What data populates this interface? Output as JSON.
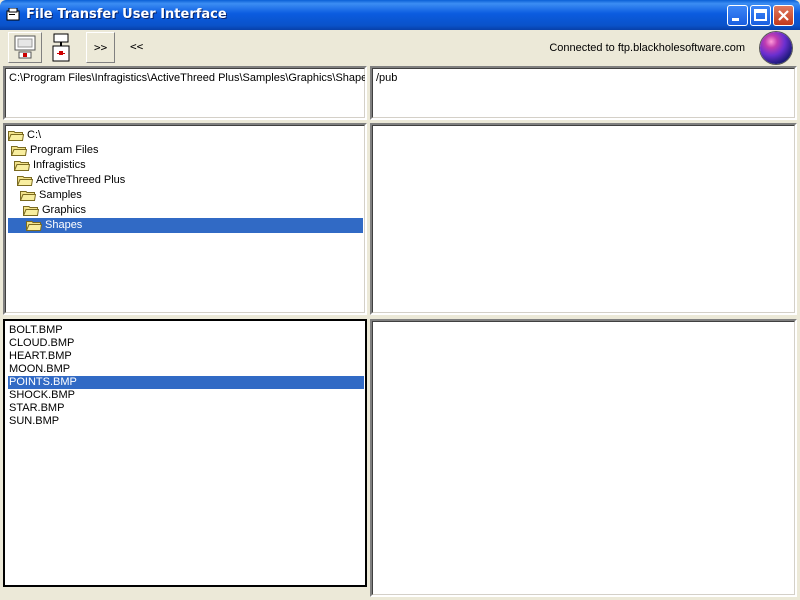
{
  "window": {
    "title": "File Transfer User Interface"
  },
  "toolbar": {
    "forward_label": ">>",
    "back_label": "<<",
    "status": "Connected to ftp.blackholesoftware.com"
  },
  "local": {
    "path": "C:\\Program Files\\Infragistics\\ActiveThreed Plus\\Samples\\Graphics\\Shapes",
    "tree": [
      {
        "label": "C:\\"
      },
      {
        "label": "Program Files"
      },
      {
        "label": "Infragistics"
      },
      {
        "label": "ActiveThreed Plus"
      },
      {
        "label": "Samples"
      },
      {
        "label": "Graphics"
      },
      {
        "label": "Shapes",
        "selected": true
      }
    ],
    "files": [
      {
        "name": "BOLT.BMP"
      },
      {
        "name": "CLOUD.BMP"
      },
      {
        "name": "HEART.BMP"
      },
      {
        "name": "MOON.BMP"
      },
      {
        "name": "POINTS.BMP",
        "selected": true
      },
      {
        "name": "SHOCK.BMP"
      },
      {
        "name": "STAR.BMP"
      },
      {
        "name": "SUN.BMP"
      }
    ]
  },
  "remote": {
    "path": "/pub"
  },
  "colors": {
    "selection": "#316ac5",
    "titlebar": "#0a5fd6"
  }
}
